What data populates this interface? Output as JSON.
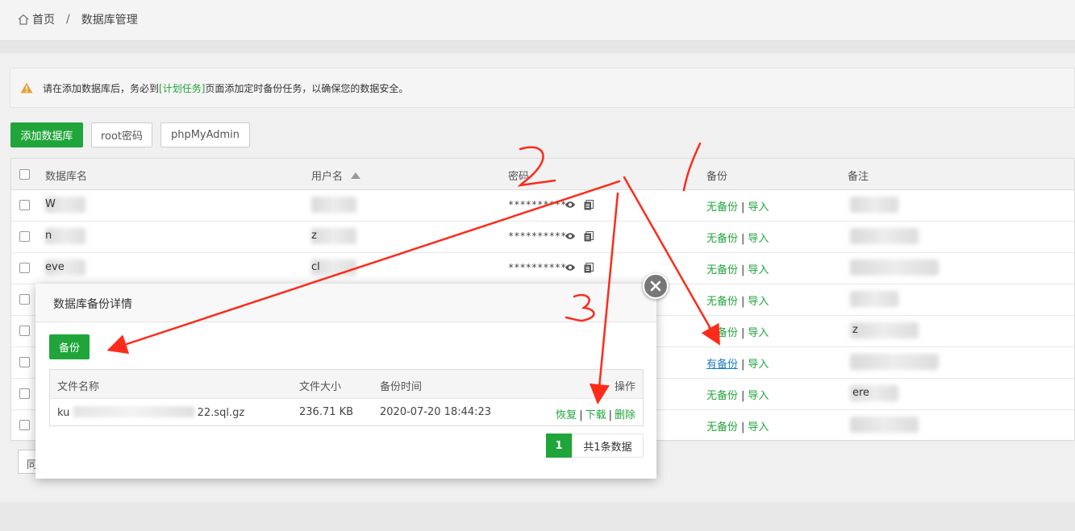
{
  "breadcrumb": {
    "home": "首页",
    "separator": "/",
    "current": "数据库管理"
  },
  "alert": {
    "prefix": "请在添加数据库后，务必到",
    "link": "[计划任务]",
    "suffix": "页面添加定时备份任务，以确保您的数据安全。"
  },
  "toolbar": {
    "add_db": "添加数据库",
    "root_pw": "root密码",
    "phpmyadmin": "phpMyAdmin"
  },
  "table": {
    "headers": {
      "name": "数据库名",
      "user": "用户名",
      "password": "密码",
      "backup": "备份",
      "note": "备注"
    },
    "rows": [
      {
        "name": "W",
        "user": "",
        "password": "**********",
        "backup": "无备份",
        "import": "导入",
        "note": ""
      },
      {
        "name": "n",
        "user": "z",
        "password": "**********",
        "backup": "无备份",
        "import": "导入",
        "note": ""
      },
      {
        "name": "eve",
        "user": "cl",
        "password": "**********",
        "backup": "无备份",
        "import": "导入",
        "note": ""
      },
      {
        "name": "",
        "user": "",
        "password": "",
        "backup": "无备份",
        "import": "导入",
        "note": ""
      },
      {
        "name": "",
        "user": "",
        "password": "",
        "backup": "无备份",
        "import": "导入",
        "note": "z"
      },
      {
        "name": "",
        "user": "",
        "password": "",
        "backup": "有备份",
        "import": "导入",
        "note": ""
      },
      {
        "name": "",
        "user": "",
        "password": "",
        "backup": "无备份",
        "import": "导入",
        "note": "ere"
      },
      {
        "name": "",
        "user": "",
        "password": "",
        "backup": "无备份",
        "import": "导入",
        "note": ""
      }
    ],
    "separator": "|"
  },
  "pager_fragment": "同",
  "modal": {
    "title": "数据库备份详情",
    "backup_button": "备份",
    "headers": {
      "filename": "文件名称",
      "size": "文件大小",
      "time": "备份时间",
      "ops": "操作"
    },
    "rows": [
      {
        "filename_start": "ku",
        "filename_end": "22.sql.gz",
        "size": "236.71 KB",
        "time": "2020-07-20 18:44:23",
        "restore": "恢复",
        "download": "下载",
        "delete": "删除"
      }
    ],
    "pagination": {
      "current": "1",
      "total": "共1条数据"
    }
  },
  "annotations": {
    "one": "1",
    "two": "2",
    "three": "3"
  },
  "colors": {
    "accent": "#20a53a",
    "annotation": "#ff2a1a"
  }
}
